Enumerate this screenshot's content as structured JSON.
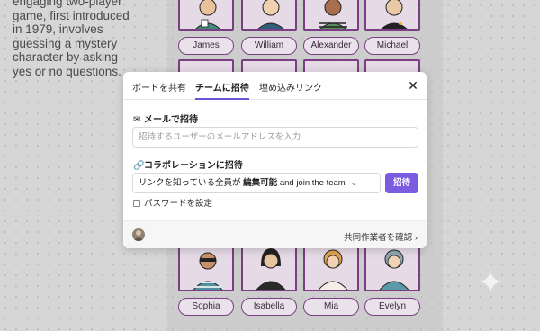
{
  "intro": {
    "lines": [
      "engaging two-player",
      "game, first introduced",
      "in 1979, involves",
      "guessing a mystery",
      "character by asking",
      "yes or no questions."
    ]
  },
  "board": {
    "top_names": [
      "James",
      "William",
      "Alexander",
      "Michael"
    ],
    "bottom_names": [
      "Sophia",
      "Isabella",
      "Mia",
      "Evelyn"
    ]
  },
  "modal": {
    "tabs": [
      "ボードを共有",
      "チームに招待",
      "埋め込みリンク"
    ],
    "active_tab": "チームに招待",
    "close_icon": "close-icon",
    "email": {
      "label": "メールで招待",
      "icon": "mail-icon",
      "placeholder": "招待するユーザーのメールアドレスを入力"
    },
    "collab": {
      "label": "コラボレーションに招待",
      "icon": "link-icon",
      "select_prefix": "リンクを知っている全員が ",
      "select_bold": "編集可能",
      "select_suffix": " and join the team",
      "invite_button": "招待"
    },
    "password_label": "パスワードを設定",
    "footer_link": "共同作業者を確認"
  },
  "colors": {
    "accent": "#7b5ce0",
    "card_border": "#7a3e82"
  }
}
